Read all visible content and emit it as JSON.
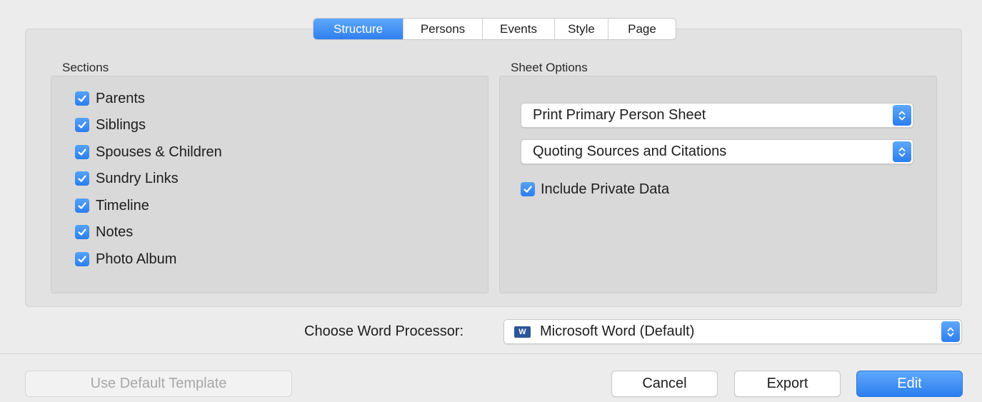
{
  "tabs": [
    {
      "label": "Structure",
      "active": true
    },
    {
      "label": "Persons",
      "active": false
    },
    {
      "label": "Events",
      "active": false
    },
    {
      "label": "Style",
      "active": false
    },
    {
      "label": "Page",
      "active": false
    }
  ],
  "sections": {
    "title": "Sections",
    "items": [
      {
        "label": "Parents",
        "checked": true
      },
      {
        "label": "Siblings",
        "checked": true
      },
      {
        "label": "Spouses & Children",
        "checked": true
      },
      {
        "label": "Sundry Links",
        "checked": true
      },
      {
        "label": "Timeline",
        "checked": true
      },
      {
        "label": "Notes",
        "checked": true
      },
      {
        "label": "Photo Album",
        "checked": true
      }
    ]
  },
  "sheet_options": {
    "title": "Sheet Options",
    "print_popup": "Print Primary Person Sheet",
    "sources_popup": "Quoting Sources and Citations",
    "include_private": {
      "label": "Include Private Data",
      "checked": true
    }
  },
  "word_processor": {
    "label": "Choose Word Processor:",
    "value": "Microsoft Word (Default)",
    "icon": "word-icon",
    "icon_letter": "W"
  },
  "buttons": {
    "default_template": "Use Default Template",
    "cancel": "Cancel",
    "export": "Export",
    "edit": "Edit"
  },
  "colors": {
    "accent": "#2f7ff0",
    "background": "#ececec"
  }
}
